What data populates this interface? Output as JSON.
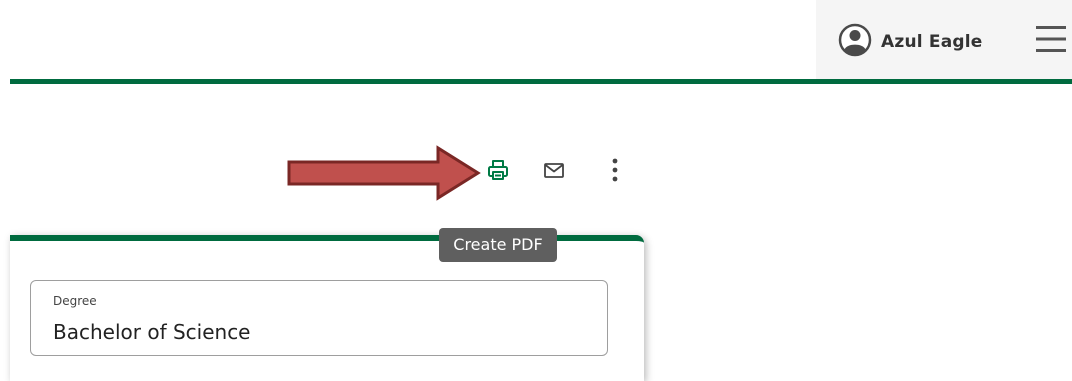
{
  "header": {
    "user_name": "Azul Eagle",
    "user_icon": "user-circle-icon",
    "menu_icon": "hamburger-menu-icon",
    "accent_color": "#006b3f"
  },
  "toolbar": {
    "print_icon": "printer-icon",
    "email_icon": "envelope-icon",
    "more_icon": "more-vertical-icon",
    "tooltip_text": "Create PDF",
    "annotation_arrow_color": "#b94646"
  },
  "form": {
    "degree": {
      "label": "Degree",
      "value": "Bachelor of Science"
    }
  }
}
